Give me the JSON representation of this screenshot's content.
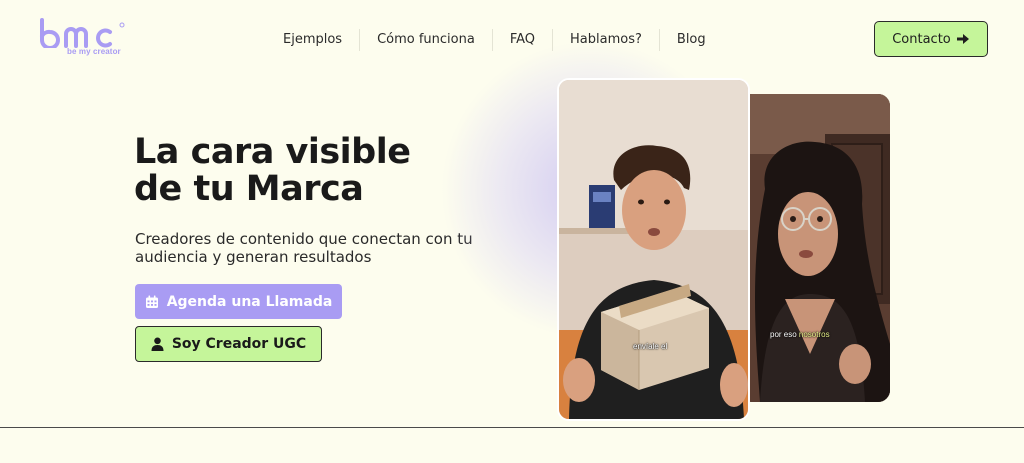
{
  "header": {
    "logo_text": "bmc",
    "logo_tagline": "be my creator",
    "nav": [
      {
        "label": "Ejemplos"
      },
      {
        "label": "Cómo funciona"
      },
      {
        "label": "FAQ"
      },
      {
        "label": "Hablamos?"
      },
      {
        "label": "Blog"
      }
    ],
    "contact_label": "Contacto",
    "contact_icon": "arrow-right-icon"
  },
  "hero": {
    "title_line1": "La cara visible",
    "title_line2": "de tu Marca",
    "subtitle": "Creadores de contenido que conectan con tu audiencia y generan resultados",
    "primary_button": {
      "label": "Agenda una Llamada",
      "icon": "calendar-icon"
    },
    "secondary_button": {
      "label": "Soy Creador UGC",
      "icon": "user-icon"
    }
  },
  "videos": {
    "front_caption": "envíale el",
    "back_caption_prefix": "por eso ",
    "back_caption_highlight": "nosotros"
  },
  "colors": {
    "background": "#fdfdee",
    "brand_purple": "#a99cf3",
    "brand_green": "#c5f59a",
    "text_dark": "#1e1e1e"
  }
}
